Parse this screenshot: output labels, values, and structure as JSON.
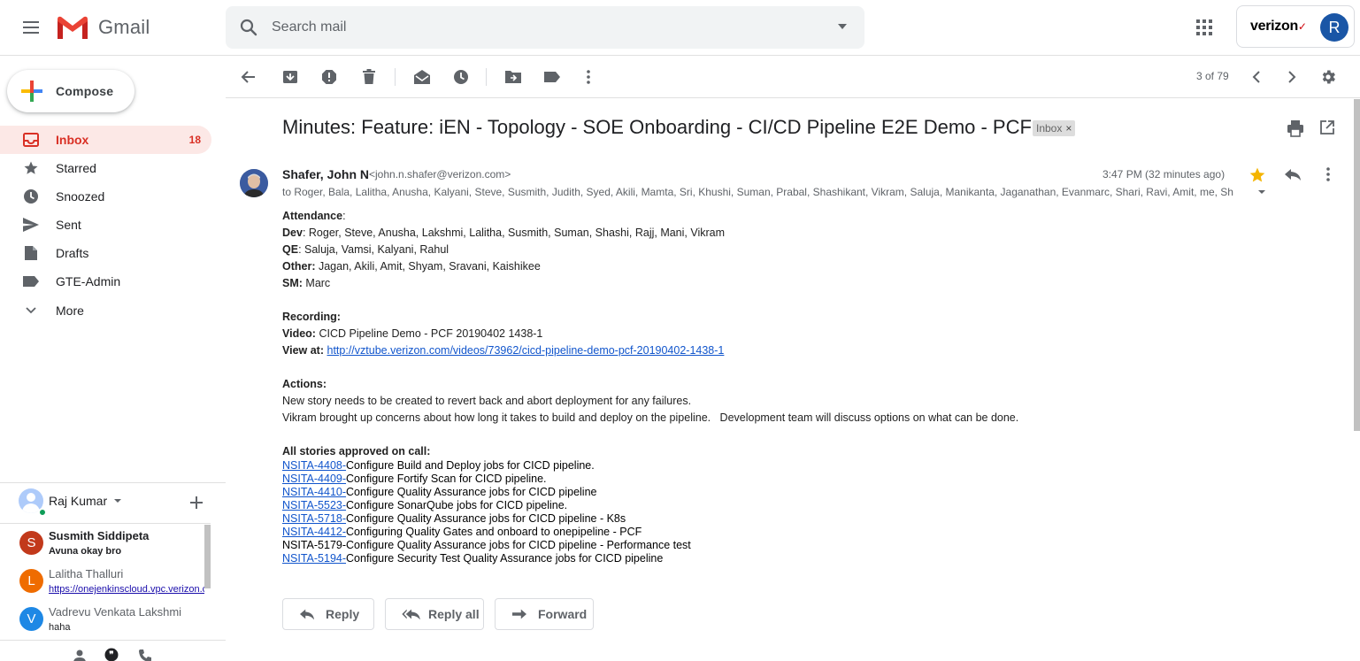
{
  "app": {
    "logo_text": "Gmail"
  },
  "search": {
    "placeholder": "Search mail"
  },
  "account": {
    "brand": "verizon",
    "avatar_letter": "R"
  },
  "compose": {
    "label": "Compose"
  },
  "sidebar": {
    "items": [
      {
        "label": "Inbox",
        "count": "18",
        "icon": "inbox-icon",
        "active": true
      },
      {
        "label": "Starred",
        "icon": "star-icon"
      },
      {
        "label": "Snoozed",
        "icon": "clock-icon"
      },
      {
        "label": "Sent",
        "icon": "send-icon"
      },
      {
        "label": "Drafts",
        "icon": "draft-icon"
      },
      {
        "label": "GTE-Admin",
        "icon": "label-icon"
      },
      {
        "label": "More",
        "icon": "chevron-down-icon"
      }
    ]
  },
  "hangouts": {
    "user": "Raj Kumar",
    "chats": [
      {
        "initial": "S",
        "name": "Susmith Siddipeta",
        "message": "Avuna okay bro",
        "color": "#c2391b",
        "unread": true
      },
      {
        "initial": "L",
        "name": "Lalitha Thalluri",
        "message": "https://onejenkinscloud.vpc.verizon.com",
        "color": "#ef6c00",
        "unread": false
      },
      {
        "initial": "V",
        "name": "Vadrevu Venkata Lakshmi",
        "message": "haha",
        "color": "#1e88e5",
        "unread": false
      }
    ]
  },
  "toolbar": {
    "pager": "3 of 79"
  },
  "message": {
    "subject": "Minutes: Feature: iEN - Topology - SOE Onboarding - CI/CD Pipeline E2E Demo - PCF",
    "label": "Inbox",
    "sender_name": "Shafer, John N",
    "sender_email": "<john.n.shafer@verizon.com>",
    "recipients": "to Roger, Bala, Lalitha, Anusha, Kalyani, Steve, Susmith, Judith, Syed, Akili, Mamta, Sri, Khushi, Suman, Prabal, Shashikant, Vikram, Saluja, Manikanta, Jaganathan, Evanmarc, Shari, Ravi, Amit, me, Sh",
    "time": "3:47 PM (32 minutes ago)",
    "attendance_heading": "Attendance",
    "attendance": [
      {
        "role": "Dev",
        "names": "Roger, Steve, Anusha, Lakshmi, Lalitha, Susmith, Suman, Shashi, Rajj, Mani, Vikram"
      },
      {
        "role": "QE",
        "names": "Saluja, Vamsi, Kalyani, Rahul"
      },
      {
        "role": "Other:",
        "names": "Jagan, Akili, Amit, Shyam, Sravani, Kaishikee"
      },
      {
        "role": "SM:",
        "names": "Marc"
      }
    ],
    "recording_heading": "Recording:",
    "video_label": "Video:",
    "video_value": "CICD Pipeline Demo - PCF 20190402 1438-1",
    "view_label": "View at:",
    "view_link": "http://vztube.verizon.com/videos/73962/cicd-pipeline-demo-pcf-20190402-1438-1",
    "actions_heading": "Actions:",
    "action_1": "New story needs to be created to revert back and abort deployment for any failures.",
    "action_2": "Vikram brought up concerns about how long it takes to build and deploy on the pipeline.   Development team will discuss options on what can be done.",
    "stories_heading": "All stories approved on call:",
    "stories": [
      {
        "id": "NSITA-4408-",
        "text": "Configure Build and Deploy jobs for CICD pipeline.",
        "linked": true
      },
      {
        "id": "NSITA-4409-",
        "text": "Configure Fortify Scan for CICD pipeline.",
        "linked": true
      },
      {
        "id": "NSITA-4410-",
        "text": "Configure Quality Assurance jobs for CICD pipeline",
        "linked": true
      },
      {
        "id": "NSITA-5523-",
        "text": "Configure SonarQube jobs for CICD pipeline.",
        "linked": true
      },
      {
        "id": "NSITA-5718-",
        "text": "Configure Quality Assurance jobs for CICD pipeline - K8s",
        "linked": true
      },
      {
        "id": "NSITA-4412-",
        "text": "Configuring Quality Gates and onboard to onepipeline - PCF",
        "linked": true
      },
      {
        "id": "NSITA-5179-",
        "text": "Configure Quality Assurance jobs for CICD pipeline - Performance test",
        "linked": false
      },
      {
        "id": "NSITA-5194-",
        "text": "Configure Security Test Quality Assurance jobs for CICD pipeline",
        "linked": true
      }
    ]
  },
  "actions": {
    "reply": "Reply",
    "reply_all": "Reply all",
    "forward": "Forward"
  },
  "colors": {
    "accent_red": "#d93025",
    "link": "#1155cc",
    "star": "#f4b400",
    "active_bg": "#fce8e6"
  }
}
